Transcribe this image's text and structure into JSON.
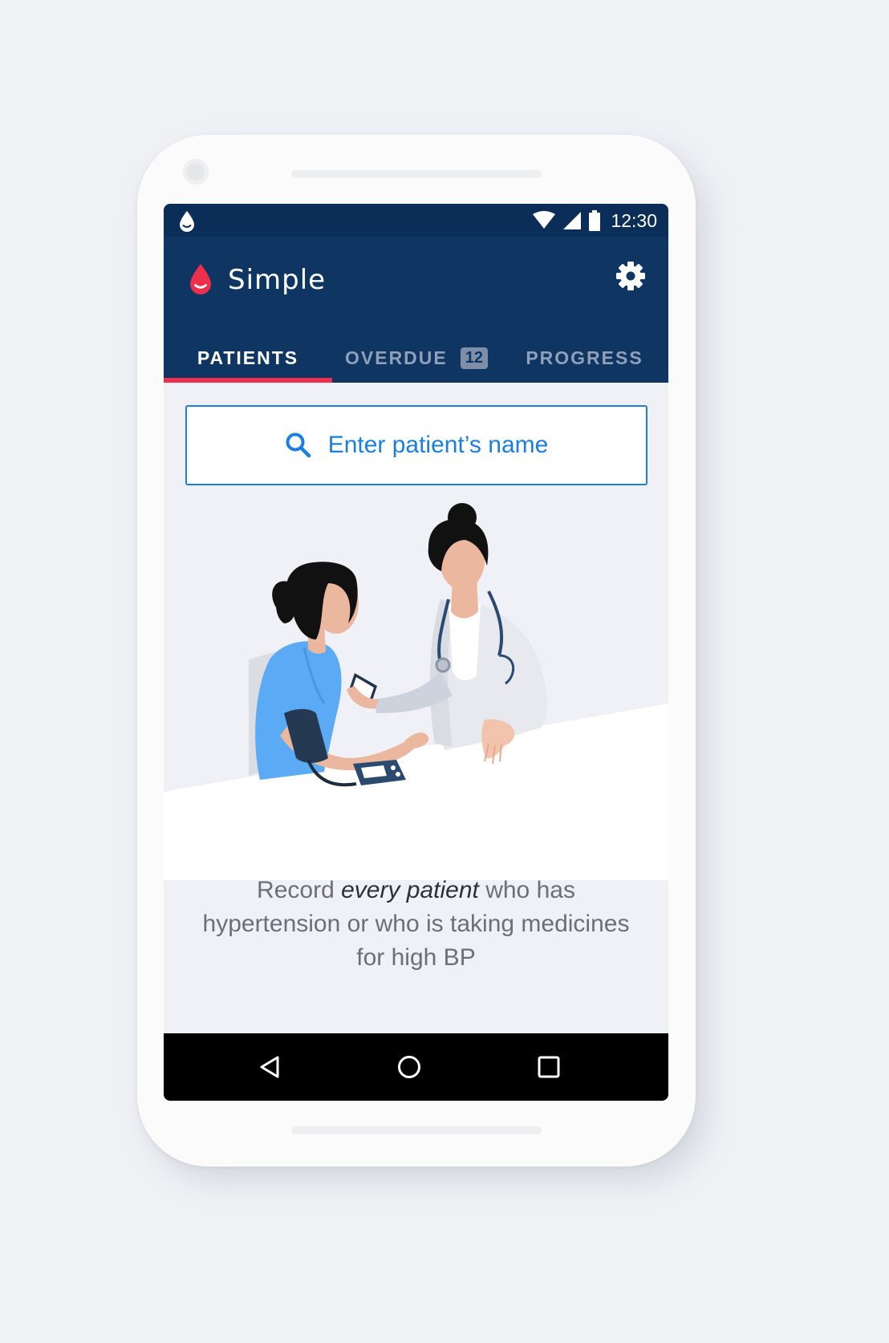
{
  "status_bar": {
    "time": "12:30",
    "icons": [
      "drop-icon",
      "wifi-icon",
      "cellular-icon",
      "battery-icon"
    ]
  },
  "app_bar": {
    "title": "Simple",
    "logo_icon": "blood-drop-logo-icon",
    "settings_icon": "gear-icon"
  },
  "tabs": [
    {
      "label": "PATIENTS",
      "active": true
    },
    {
      "label": "OVERDUE",
      "badge": "12",
      "active": false
    },
    {
      "label": "PROGRESS",
      "active": false
    }
  ],
  "search": {
    "placeholder": "Enter patient’s name",
    "icon": "search-icon"
  },
  "empty_state": {
    "caption_before": "Record ",
    "caption_emphasis": "every patient",
    "caption_after": " who has hypertension or who is taking medicines for high BP"
  },
  "nav_bar": {
    "icons": [
      "back-icon",
      "home-icon",
      "recents-icon"
    ]
  },
  "colors": {
    "app_bar": "#0f3662",
    "status_bar": "#0b2e58",
    "accent_red": "#ee2f4b",
    "accent_blue": "#1a7fe0",
    "background": "#eff1f6"
  }
}
